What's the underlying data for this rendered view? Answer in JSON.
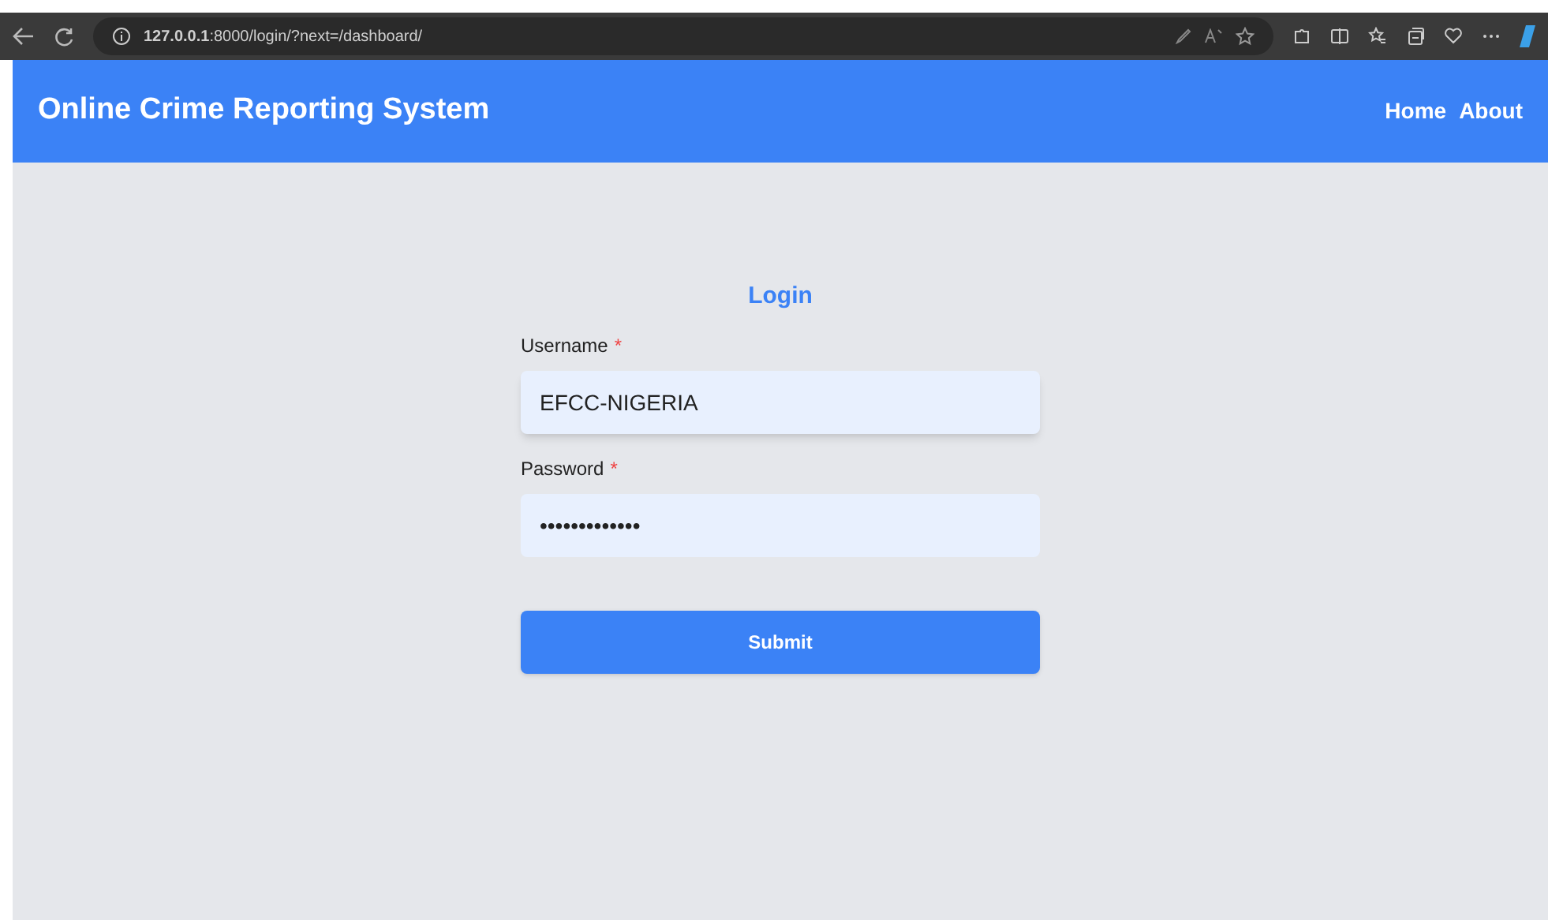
{
  "browser": {
    "url": "**127.0.0.1**:8000/login/?next=/dashboard/"
  },
  "navbar": {
    "title": "Online Crime Reporting System",
    "links": [
      "Home",
      "About"
    ]
  },
  "form": {
    "title": "Login",
    "fields": [
      {
        "label": "Username",
        "required": "*",
        "value": "EFCC-NIGERIA",
        "focused": true
      },
      {
        "label": "Password",
        "required": "*",
        "value": "•••••••••••••",
        "focused": false
      }
    ],
    "submit": "Submit"
  }
}
